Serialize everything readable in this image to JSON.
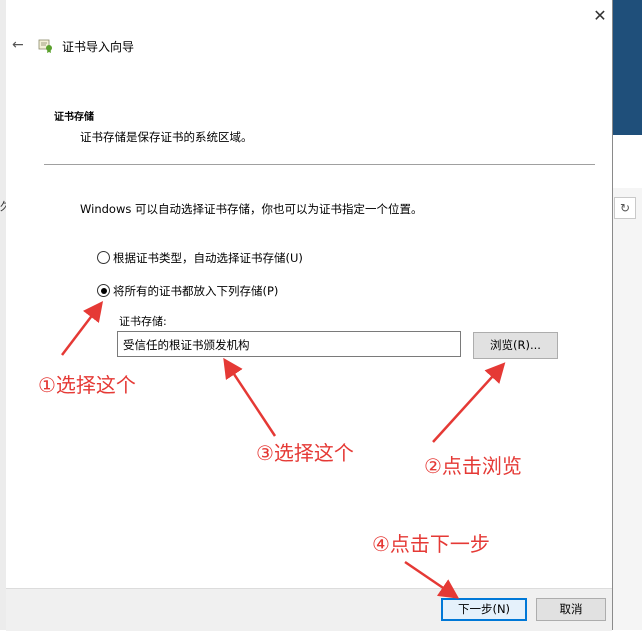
{
  "wizard": {
    "title": "证书导入向导",
    "back_icon": "←",
    "close_icon": "✕"
  },
  "header": {
    "title": "证书存储",
    "subtitle": "证书存储是保存证书的系统区域。"
  },
  "body": {
    "description": "Windows 可以自动选择证书存储，你也可以为证书指定一个位置。",
    "options": [
      {
        "label": "根据证书类型，自动选择证书存储(U)",
        "checked": false
      },
      {
        "label": "将所有的证书都放入下列存储(P)",
        "checked": true
      }
    ],
    "store_label": "证书存储:",
    "store_value": "受信任的根证书颁发机构",
    "browse_label": "浏览(R)..."
  },
  "footer": {
    "next_label": "下一步(N)",
    "cancel_label": "取消"
  },
  "annotations": {
    "a1": "①选择这个",
    "a2": "②点击浏览",
    "a3": "③选择这个",
    "a4": "④点击下一步"
  },
  "background": {
    "left_char": "久",
    "refresh_icon": "↻"
  },
  "colors": {
    "accent": "#0078d7",
    "annotation": "#e53935"
  }
}
